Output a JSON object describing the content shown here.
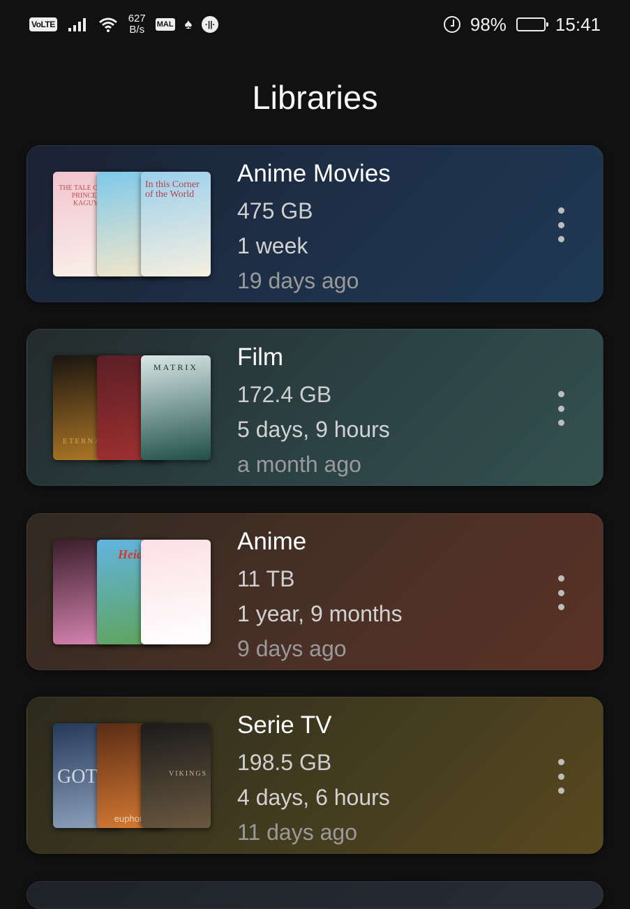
{
  "status_bar": {
    "volte": "VoLTE",
    "net_speed_value": "627",
    "net_speed_unit": "B/s",
    "mal_label": "MAL",
    "battery_percent": "98%",
    "battery_level": 0.98,
    "time": "15:41"
  },
  "page": {
    "title": "Libraries"
  },
  "libraries": [
    {
      "name": "Anime Movies",
      "size": "475 GB",
      "duration": "1 week",
      "updated": "19 days ago",
      "posters": [
        {
          "text": "THE TALE OF THE PRINCESS KAGUYA",
          "colors": [
            "#f1c5cf",
            "#faf1ea"
          ]
        },
        {
          "text": "",
          "colors": [
            "#7ec9ea",
            "#f5e7c9"
          ]
        },
        {
          "text": "In this Corner of the World",
          "colors": [
            "#9cd0ec",
            "#f5efe0"
          ]
        }
      ]
    },
    {
      "name": "Film",
      "size": "172.4 GB",
      "duration": "5 days, 9 hours",
      "updated": "a month ago",
      "posters": [
        {
          "text": "ETERNALS",
          "colors": [
            "#1a1410",
            "#b07a28"
          ]
        },
        {
          "text": "",
          "colors": [
            "#5a1f26",
            "#a03030"
          ]
        },
        {
          "text": "MATRIX",
          "colors": [
            "#d9e8e7",
            "#1f4f47"
          ]
        }
      ]
    },
    {
      "name": "Anime",
      "size": "11 TB",
      "duration": "1 year, 9 months",
      "updated": "9 days ago",
      "posters": [
        {
          "text": "",
          "colors": [
            "#3a1e2a",
            "#d986b4"
          ]
        },
        {
          "text": "Heidi",
          "colors": [
            "#62b4e0",
            "#5fa35a"
          ]
        },
        {
          "text": "",
          "colors": [
            "#fbe0e6",
            "#ffffff"
          ]
        }
      ]
    },
    {
      "name": "Serie TV",
      "size": "198.5 GB",
      "duration": "4 days, 6 hours",
      "updated": "11 days ago",
      "posters": [
        {
          "text": "GOT",
          "colors": [
            "#25395a",
            "#8ea3bc"
          ]
        },
        {
          "text": "euphoria",
          "colors": [
            "#5a2c15",
            "#d77b33"
          ]
        },
        {
          "text": "VIKINGS",
          "colors": [
            "#1b1b1b",
            "#6a5840"
          ]
        }
      ]
    }
  ]
}
